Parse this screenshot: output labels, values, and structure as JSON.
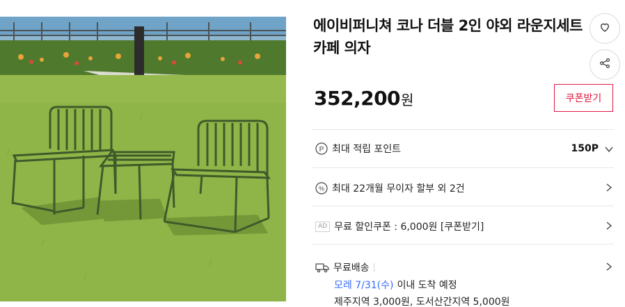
{
  "product": {
    "title": "에이비퍼니쳐 코나 더블 2인 야외 라운지세트 카페 의자",
    "price": "352,200",
    "price_unit": "원",
    "coupon_button": "쿠폰받기",
    "photo_icon": "product-photo"
  },
  "actions": {
    "wishlist_icon": "heart-icon",
    "share_icon": "share-icon"
  },
  "benefits": {
    "points_label": "최대 적립 포인트",
    "points_value": "150P",
    "installment_label": "최대 22개월 무이자 할부 외 2건",
    "ad_badge": "AD",
    "coupon_label": "무료 할인쿠폰 : 6,000원 [쿠폰받기]"
  },
  "shipping": {
    "label": "무료배송",
    "arrival_date": "모레 7/31(수)",
    "arrival_text": "이내 도착 예정",
    "extra_fee": "제주지역 3,000원, 도서산간지역 5,000원"
  },
  "colors": {
    "accent_red": "#e0173e",
    "accent_blue": "#346aff"
  }
}
